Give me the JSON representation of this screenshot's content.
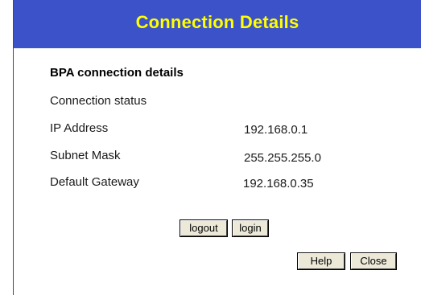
{
  "header": {
    "title": "Connection Details"
  },
  "section": {
    "heading": "BPA connection details"
  },
  "rows": [
    {
      "label": "Connection status",
      "value": ""
    },
    {
      "label": "IP Address",
      "value": "192.168.0.1"
    },
    {
      "label": "Subnet Mask",
      "value": "255.255.255.0"
    },
    {
      "label": "Default Gateway",
      "value": "192.168.0.35"
    }
  ],
  "actions": {
    "logout_label": "logout",
    "login_label": "login"
  },
  "footer": {
    "help_label": "Help",
    "close_label": "Close"
  },
  "colors": {
    "title_background": "#3c52c8",
    "title_text": "#ffff00"
  }
}
